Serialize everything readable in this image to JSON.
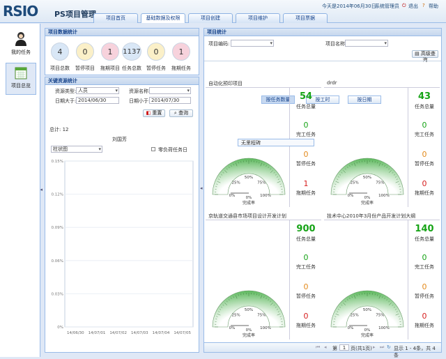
{
  "header": {
    "logo": "RSIO",
    "app_title": "PS项目管理",
    "date_text": "今天是2014年06月30日",
    "admin": "系统管理员",
    "logout": "退出",
    "help": "帮助",
    "tabs": [
      "项目首页",
      "基础数据及权限",
      "项目创建",
      "项目维护",
      "项目票据"
    ]
  },
  "left_nav": [
    {
      "label": "我的任务",
      "icon": "user-icon"
    },
    {
      "label": "项目总览",
      "icon": "calendar-icon"
    }
  ],
  "project_stats": {
    "title": "项目数据统计",
    "items": [
      {
        "value": "4",
        "label": "项目总数",
        "color": "#d9e7f6"
      },
      {
        "value": "0",
        "label": "暂停项目",
        "color": "#fbf0c8"
      },
      {
        "value": "1",
        "label": "拖期项目",
        "color": "#f7d2dc"
      },
      {
        "value": "1137",
        "label": "任务总数",
        "color": "#d9e7f6"
      },
      {
        "value": "0",
        "label": "暂停任务",
        "color": "#fbf0c8"
      },
      {
        "value": "1",
        "label": "拖期任务",
        "color": "#f7d2dc"
      }
    ]
  },
  "resource_stats": {
    "title": "关键资源统计",
    "type_label": "资源类型:",
    "type_value": "人员",
    "name_label": "资源名称:",
    "name_value": "",
    "date_from_label": "日期大于:",
    "date_from": "2014/06/30",
    "date_to_label": "日期小于:",
    "date_to": "2014/07/30",
    "reset": "重置",
    "query": "查询",
    "total": "总计: 12",
    "person": "刘国芳",
    "chart_type": "柱状图",
    "checkbox_label": "零负荷任务日"
  },
  "chart_data": {
    "type": "bar",
    "categories": [
      "14/06/30",
      "14/07/01",
      "14/07/02",
      "14/07/03",
      "14/07/04",
      "14/07/05"
    ],
    "values": [
      0,
      0,
      0,
      0,
      0,
      0
    ],
    "ylim": [
      0,
      0.15
    ],
    "yticks": [
      "0.15%",
      "0.12%",
      "0.09%",
      "0.06%",
      "0.03%",
      "0%"
    ],
    "grid": true
  },
  "project_panel": {
    "title": "项目统计",
    "code_label": "项目编码:",
    "code_value": "",
    "name_label": "项目名称:",
    "name_value": "",
    "advanced": "高级查询",
    "tabs": [
      "按任务数量",
      "按工时",
      "按日期"
    ],
    "tooltip": "无里程碑",
    "cards": [
      {
        "title": "自动化预印项目",
        "total": "54",
        "done": "0",
        "paused": "0",
        "delayed": "1",
        "rate": "0%"
      },
      {
        "title": "drdr",
        "total": "43",
        "done": "0",
        "paused": "0",
        "delayed": "0",
        "rate": "0%"
      },
      {
        "title": "京轨道交通县市场项目设计开发计划",
        "total": "900",
        "done": "0",
        "paused": "0",
        "delayed": "0",
        "rate": "0%"
      },
      {
        "title": "技术中心2010年3月份产品开发计划大纲",
        "total": "140",
        "done": "0",
        "paused": "0",
        "delayed": "0",
        "rate": "0%"
      }
    ],
    "labels": {
      "total": "任务总量",
      "done": "完工任务",
      "paused": "暂停任务",
      "delayed": "拖期任务",
      "rate": "完成率"
    },
    "gauge_ticks": [
      "0%",
      "25%",
      "50%",
      "75%",
      "100%"
    ],
    "pager": {
      "page_prefix": "第",
      "page_value": "1",
      "page_suffix": "页(共1页)",
      "display": "显示 1 - 4条，共 4 条"
    }
  },
  "colors": {
    "green": "#16a316",
    "orange": "#e38a1c",
    "red": "#d61e1e"
  }
}
